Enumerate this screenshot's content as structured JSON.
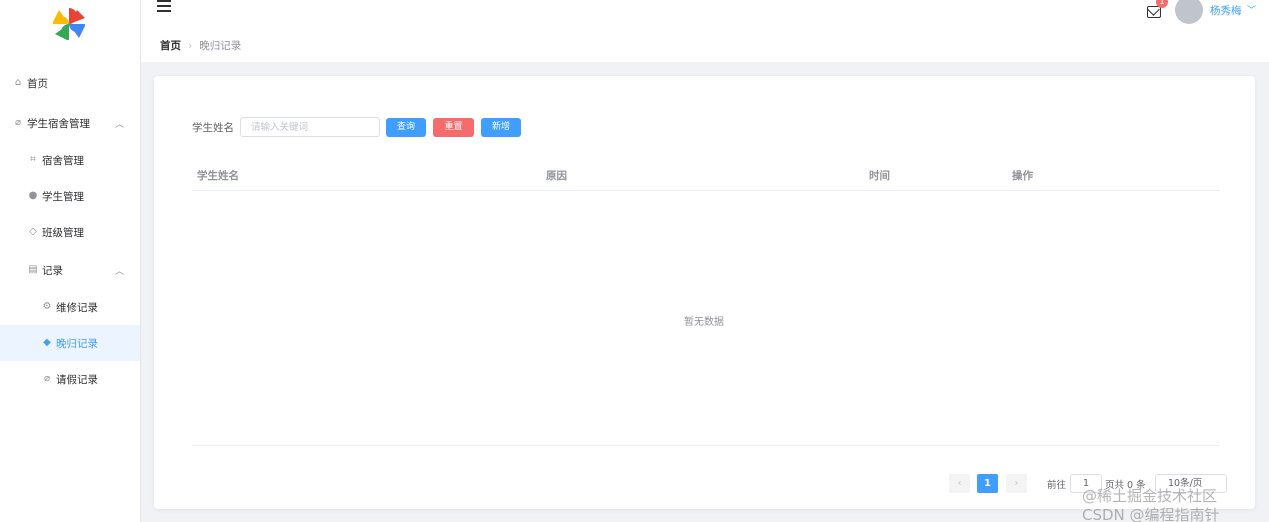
{
  "sidebar": {
    "items": [
      {
        "label": "首页",
        "icon": "home-icon"
      },
      {
        "label": "学生宿舍管理",
        "icon": "paperclip-icon"
      },
      {
        "label": "宿舍管理",
        "icon": "crop-icon"
      },
      {
        "label": "学生管理",
        "icon": "user-icon"
      },
      {
        "label": "班级管理",
        "icon": "graduation-icon"
      },
      {
        "label": "记录",
        "icon": "document-icon"
      },
      {
        "label": "维修记录",
        "icon": "gear-icon"
      },
      {
        "label": "晚归记录",
        "icon": "tag-icon"
      },
      {
        "label": "请假记录",
        "icon": "paperclip-icon"
      }
    ],
    "active_item": "晚归记录"
  },
  "header": {
    "breadcrumb_home": "首页",
    "breadcrumb_current": "晚归记录",
    "notification_count": "1",
    "username": "杨秀梅"
  },
  "search": {
    "label": "学生姓名",
    "placeholder": "请输入关键词",
    "value": "",
    "query_label": "查询",
    "reset_label": "重置",
    "add_label": "新增"
  },
  "table": {
    "columns": [
      "学生姓名",
      "原因",
      "时间",
      "操作"
    ],
    "rows": [],
    "empty_text": "暂无数据"
  },
  "pagination": {
    "current_page": "1",
    "goto_label": "前往",
    "goto_value": "1",
    "total_text": "页共 0 条",
    "page_size": "10条/页"
  },
  "watermark": {
    "line1": "@稀土掘金技术社区",
    "line2": "CSDN @编程指南针"
  },
  "colors": {
    "primary": "#409eff",
    "danger": "#f56c6c",
    "background": "#f0f2f5",
    "active_menu_bg": "#ecf5ff"
  }
}
